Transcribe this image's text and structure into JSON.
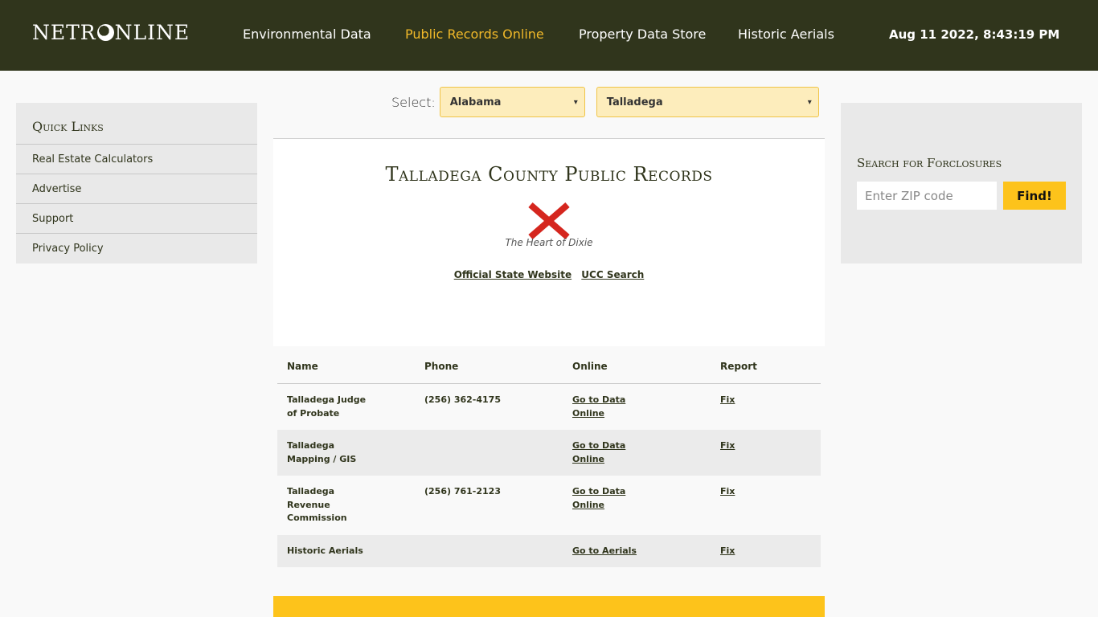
{
  "header": {
    "logo": {
      "left": "NETR",
      "right": "NLINE",
      "icon": "globe-icon"
    },
    "nav": [
      {
        "label": "Environmental Data",
        "active": false
      },
      {
        "label": "Public Records Online",
        "active": true
      },
      {
        "label": "Property Data Store",
        "active": false
      },
      {
        "label": "Historic Aerials",
        "active": false
      }
    ],
    "datetime": "Aug 11 2022, 8:43:19 PM"
  },
  "selector": {
    "label": "Select:",
    "state": "Alabama",
    "county": "Talladega",
    "chevron": "▾"
  },
  "quick_links": {
    "title": "Quick Links",
    "items": [
      "Real Estate Calculators",
      "Advertise",
      "Support",
      "Privacy Policy"
    ]
  },
  "main": {
    "title": "Talladega County Public Records",
    "flag_icon": "alabama-flag-icon",
    "motto": "The Heart of Dixie",
    "links": [
      "Official State Website",
      "UCC Search"
    ]
  },
  "table": {
    "headers": [
      "Name",
      "Phone",
      "Online",
      "Report"
    ],
    "rows": [
      {
        "name": "Talladega Judge of Probate",
        "phone": "(256) 362-4175",
        "online": "Go to Data Online",
        "report": "Fix"
      },
      {
        "name": "Talladega Mapping / GIS",
        "phone": "",
        "online": "Go to Data Online",
        "report": "Fix"
      },
      {
        "name": "Talladega Revenue Commission",
        "phone": "(256) 761-2123",
        "online": "Go to Data Online",
        "report": "Fix"
      },
      {
        "name": "Historic Aerials",
        "phone": "",
        "online": "Go to Aerials",
        "report": "Fix"
      }
    ]
  },
  "foreclosure_search": {
    "title": "Search for Forclosures",
    "placeholder": "Enter ZIP code",
    "button": "Find!"
  },
  "colors": {
    "header_bg": "#30351c",
    "accent": "#f0b829",
    "button": "#fdc31b",
    "flag_red": "#d5261e"
  }
}
